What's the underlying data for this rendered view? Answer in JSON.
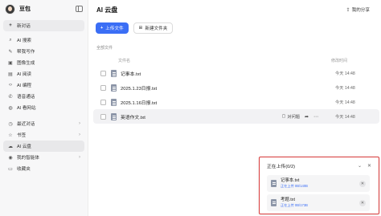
{
  "app": {
    "name": "豆包"
  },
  "sidebar": {
    "items": [
      {
        "label": "新对话",
        "icon": "plus-icon"
      },
      {
        "label": "AI 搜索",
        "icon": "search-icon"
      },
      {
        "label": "帮我写作",
        "icon": "pen-icon"
      },
      {
        "label": "图像生成",
        "icon": "image-icon"
      },
      {
        "label": "AI 阅读",
        "icon": "book-icon"
      },
      {
        "label": "AI 编程",
        "icon": "code-icon"
      },
      {
        "label": "语音通话",
        "icon": "phone-icon"
      },
      {
        "label": "AI 看网站",
        "icon": "globe-icon"
      },
      {
        "label": "最近对话",
        "icon": "clock-icon"
      },
      {
        "label": "书签",
        "icon": "star-icon"
      },
      {
        "label": "AI 云盘",
        "icon": "cloud-icon"
      },
      {
        "label": "我的智能体",
        "icon": "bot-icon"
      },
      {
        "label": "收藏夹",
        "icon": "bookmark-icon"
      }
    ]
  },
  "main": {
    "title": "AI 云盘",
    "share_label": "我的分享",
    "upload_button": "上传文件",
    "new_folder_button": "新建文件夹",
    "section_label": "全部文件",
    "columns": {
      "name": "文件名",
      "time": "修改时间"
    },
    "files": [
      {
        "name": "记事本.txt",
        "time": "今天 14:48"
      },
      {
        "name": "2025.1.23日报.txt",
        "time": "今天 14:48"
      },
      {
        "name": "2025.1.16日报.txt",
        "time": "今天 14:48"
      },
      {
        "name": "英语作文.txt",
        "time": "今天 14:48"
      }
    ],
    "row_action_chat": "对问题"
  },
  "upload_panel": {
    "title": "正在上传(0/2)",
    "items": [
      {
        "name": "记事本.txt",
        "status": "正在上传  0B/140B"
      },
      {
        "name": "考题.txt",
        "status": "正在上传  0B/173B"
      }
    ]
  },
  "colors": {
    "accent": "#3b6ef5",
    "highlight_border": "#d93a3a"
  }
}
